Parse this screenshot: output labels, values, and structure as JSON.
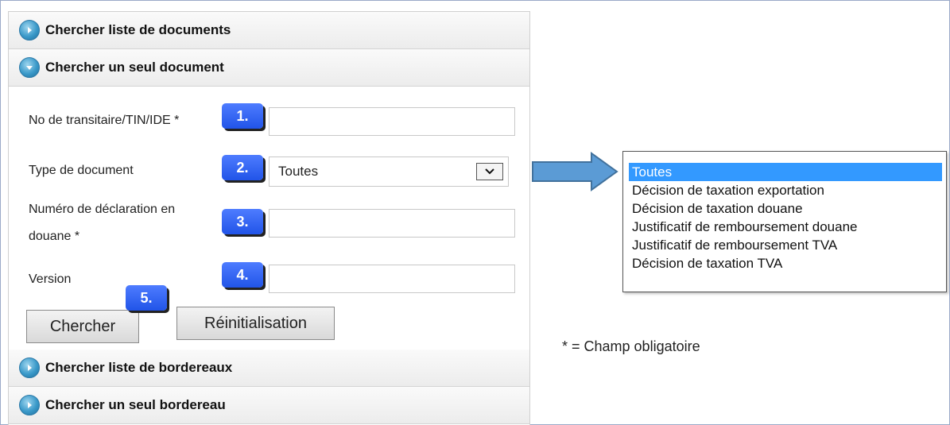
{
  "accordion": {
    "search_document_list": "Chercher liste de documents",
    "search_single_document": "Chercher un seul document",
    "search_slip_list": "Chercher liste de bordereaux",
    "search_single_slip": "Chercher un seul bordereau"
  },
  "form": {
    "forwarder_label": "No de transitaire/TIN/IDE *",
    "forwarder_value": "",
    "doc_type_label": "Type de document",
    "doc_type_value": "Toutes",
    "declaration_label_line1": "Numéro de déclaration en",
    "declaration_label_line2": "douane *",
    "declaration_value": "",
    "version_label": "Version",
    "version_value": "",
    "search_button": "Chercher",
    "reset_button": "Réinitialisation"
  },
  "badges": [
    "1.",
    "2.",
    "3.",
    "4.",
    "5."
  ],
  "dropdown": {
    "options": [
      "Toutes",
      "Décision de taxation exportation",
      "Décision de taxation douane",
      "Justificatif de remboursement douane",
      "Justificatif de remboursement TVA",
      "Décision de taxation TVA"
    ],
    "selected": "Toutes"
  },
  "note": "* = Champ obligatoire",
  "colors": {
    "badge": "#2154e8",
    "arrow": "#5b9bd5",
    "selected_option": "#3399ff",
    "accordion_icon": "#3a99c9"
  },
  "icons": {
    "collapsed": "expand-arrow-icon",
    "expanded": "collapse-arrow-icon",
    "select": "chevron-down-icon"
  }
}
